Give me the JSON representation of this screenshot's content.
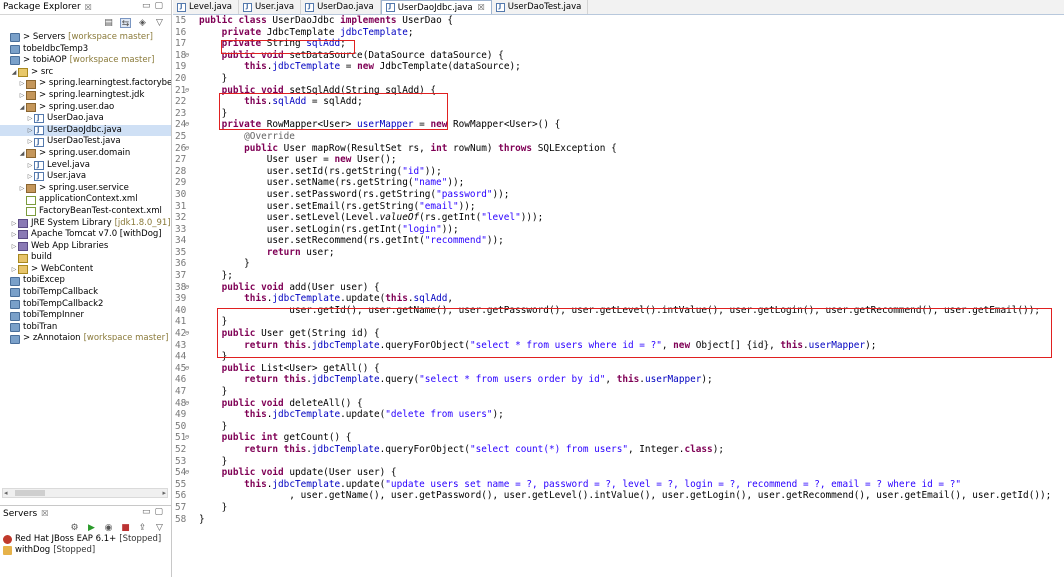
{
  "package_explorer": {
    "title": "Package Explorer",
    "close_glyph": "☒",
    "tree": [
      {
        "indent": 0,
        "twisty": "",
        "icon": "project",
        "label": "> Servers",
        "deco": "[workspace master]"
      },
      {
        "indent": 0,
        "twisty": "",
        "icon": "project",
        "label": "tobeIdbcTemp3",
        "deco": ""
      },
      {
        "indent": 0,
        "twisty": "",
        "icon": "project",
        "label": "> tobiAOP",
        "deco": "[workspace master]"
      },
      {
        "indent": 1,
        "twisty": "◢",
        "icon": "srcfolder",
        "label": "> src",
        "deco": ""
      },
      {
        "indent": 2,
        "twisty": "▷",
        "icon": "package",
        "label": "> spring.learningtest.factorybean",
        "deco": ""
      },
      {
        "indent": 2,
        "twisty": "▷",
        "icon": "package",
        "label": "> spring.learningtest.jdk",
        "deco": ""
      },
      {
        "indent": 2,
        "twisty": "◢",
        "icon": "package",
        "label": "> spring.user.dao",
        "deco": ""
      },
      {
        "indent": 3,
        "twisty": "▷",
        "icon": "java",
        "label": "UserDao.java",
        "deco": ""
      },
      {
        "indent": 3,
        "twisty": "▷",
        "icon": "java",
        "label": "UserDaoJdbc.java",
        "deco": "",
        "selected": true
      },
      {
        "indent": 3,
        "twisty": "▷",
        "icon": "java",
        "label": "UserDaoTest.java",
        "deco": ""
      },
      {
        "indent": 2,
        "twisty": "◢",
        "icon": "package",
        "label": "> spring.user.domain",
        "deco": ""
      },
      {
        "indent": 3,
        "twisty": "▷",
        "icon": "java",
        "label": "Level.java",
        "deco": ""
      },
      {
        "indent": 3,
        "twisty": "▷",
        "icon": "java",
        "label": "User.java",
        "deco": ""
      },
      {
        "indent": 2,
        "twisty": "▷",
        "icon": "package",
        "label": "> spring.user.service",
        "deco": ""
      },
      {
        "indent": 2,
        "twisty": "",
        "icon": "xml",
        "label": "applicationContext.xml",
        "deco": ""
      },
      {
        "indent": 2,
        "twisty": "",
        "icon": "xml",
        "label": "FactoryBeanTest-context.xml",
        "deco": ""
      },
      {
        "indent": 1,
        "twisty": "▷",
        "icon": "lib",
        "label": "JRE System Library",
        "deco": "[jdk1.8.0_91]"
      },
      {
        "indent": 1,
        "twisty": "▷",
        "icon": "lib",
        "label": "Apache Tomcat v7.0 [withDog]",
        "deco": ""
      },
      {
        "indent": 1,
        "twisty": "▷",
        "icon": "lib",
        "label": "Web App Libraries",
        "deco": ""
      },
      {
        "indent": 1,
        "twisty": "",
        "icon": "folder",
        "label": "build",
        "deco": ""
      },
      {
        "indent": 1,
        "twisty": "▷",
        "icon": "folder",
        "label": "> WebContent",
        "deco": ""
      },
      {
        "indent": 0,
        "twisty": "",
        "icon": "project",
        "label": "tobiExcep",
        "deco": ""
      },
      {
        "indent": 0,
        "twisty": "",
        "icon": "project",
        "label": "tobiTempCallback",
        "deco": ""
      },
      {
        "indent": 0,
        "twisty": "",
        "icon": "project",
        "label": "tobiTempCallback2",
        "deco": ""
      },
      {
        "indent": 0,
        "twisty": "",
        "icon": "project",
        "label": "tobiTempInner",
        "deco": ""
      },
      {
        "indent": 0,
        "twisty": "",
        "icon": "project",
        "label": "tobiTran",
        "deco": ""
      },
      {
        "indent": 0,
        "twisty": "",
        "icon": "project",
        "label": "> zAnnotaion",
        "deco": "[workspace master]"
      }
    ]
  },
  "servers_view": {
    "title": "Servers",
    "close_glyph": "☒",
    "items": [
      {
        "icon": "jboss",
        "label": "Red Hat JBoss EAP 6.1+",
        "status": "[Stopped]"
      },
      {
        "icon": "tomcat",
        "label": "withDog",
        "status": "[Stopped]"
      }
    ]
  },
  "editor": {
    "tabs": [
      {
        "label": "Level.java",
        "active": false
      },
      {
        "label": "User.java",
        "active": false
      },
      {
        "label": "UserDao.java",
        "active": false
      },
      {
        "label": "UserDaoJdbc.java",
        "active": true
      },
      {
        "label": "UserDaoTest.java",
        "active": false
      }
    ],
    "tab_close_glyph": "☒",
    "lines": [
      {
        "n": "15",
        "fold": false,
        "t": "[k]public class[/k] UserDaoJdbc [k]implements[/k] UserDao {"
      },
      {
        "n": "16",
        "fold": false,
        "t": "    [k]private[/k] JdbcTemplate [f]jdbcTemplate[/f];"
      },
      {
        "n": "17",
        "fold": false,
        "t": "    [k]private[/k] String [f]sqlAdd[/f];"
      },
      {
        "n": "18",
        "fold": true,
        "t": "    [k]public void[/k] setDataSource(DataSource dataSource) {"
      },
      {
        "n": "19",
        "fold": false,
        "t": "        [k]this[/k].[f]jdbcTemplate[/f] = [k]new[/k] JdbcTemplate(dataSource);"
      },
      {
        "n": "20",
        "fold": false,
        "t": "    }"
      },
      {
        "n": "21",
        "fold": true,
        "t": "    [k]public void[/k] setSqlAdd(String sqlAdd) {"
      },
      {
        "n": "22",
        "fold": false,
        "t": "        [k]this[/k].[f]sqlAdd[/f] = sqlAdd;"
      },
      {
        "n": "23",
        "fold": false,
        "t": "    }"
      },
      {
        "n": "24",
        "fold": true,
        "t": "    [k]private[/k] RowMapper<User> [f]userMapper[/f] = [k]new[/k] RowMapper<User>() {"
      },
      {
        "n": "25",
        "fold": false,
        "t": "        [a]@Override[/a]"
      },
      {
        "n": "26",
        "fold": true,
        "t": "        [k]public[/k] User mapRow(ResultSet rs, [k]int[/k] rowNum) [k]throws[/k] SQLException {"
      },
      {
        "n": "27",
        "fold": false,
        "t": "            User user = [k]new[/k] User();"
      },
      {
        "n": "28",
        "fold": false,
        "t": "            user.setId(rs.getString([s]\"id\"[/s]));"
      },
      {
        "n": "29",
        "fold": false,
        "t": "            user.setName(rs.getString([s]\"name\"[/s]));"
      },
      {
        "n": "30",
        "fold": false,
        "t": "            user.setPassword(rs.getString([s]\"password\"[/s]));"
      },
      {
        "n": "31",
        "fold": false,
        "t": "            user.setEmail(rs.getString([s]\"email\"[/s]));"
      },
      {
        "n": "32",
        "fold": false,
        "t": "            user.setLevel(Level.[i]valueOf[/i](rs.getInt([s]\"level\"[/s])));"
      },
      {
        "n": "33",
        "fold": false,
        "t": "            user.setLogin(rs.getInt([s]\"login\"[/s]));"
      },
      {
        "n": "34",
        "fold": false,
        "t": "            user.setRecommend(rs.getInt([s]\"recommend\"[/s]));"
      },
      {
        "n": "35",
        "fold": false,
        "t": "            [k]return[/k] user;"
      },
      {
        "n": "36",
        "fold": false,
        "t": "        }"
      },
      {
        "n": "37",
        "fold": false,
        "t": "    };"
      },
      {
        "n": "38",
        "fold": true,
        "t": "    [k]public void[/k] add(User user) {"
      },
      {
        "n": "39",
        "fold": false,
        "t": "        [k]this[/k].[f]jdbcTemplate[/f].update([k]this[/k].[f]sqlAdd[/f],"
      },
      {
        "n": "40",
        "fold": false,
        "t": "                user.getId(), user.getName(), user.getPassword(), user.getLevel().intValue(), user.getLogin(), user.getRecommend(), user.getEmail());"
      },
      {
        "n": "41",
        "fold": false,
        "t": "    }"
      },
      {
        "n": "42",
        "fold": true,
        "t": "    [k]public[/k] User get(String id) {"
      },
      {
        "n": "43",
        "fold": false,
        "t": "        [k]return this[/k].[f]jdbcTemplate[/f].queryForObject([s]\"select * from users where id = ?\"[/s], [k]new[/k] Object[] {id}, [k]this[/k].[f]userMapper[/f]);"
      },
      {
        "n": "44",
        "fold": false,
        "t": "    }"
      },
      {
        "n": "45",
        "fold": true,
        "t": "    [k]public[/k] List<User> getAll() {"
      },
      {
        "n": "46",
        "fold": false,
        "t": "        [k]return this[/k].[f]jdbcTemplate[/f].query([s]\"select * from users order by id\"[/s], [k]this[/k].[f]userMapper[/f]);"
      },
      {
        "n": "47",
        "fold": false,
        "t": "    }"
      },
      {
        "n": "48",
        "fold": true,
        "t": "    [k]public void[/k] deleteAll() {"
      },
      {
        "n": "49",
        "fold": false,
        "t": "        [k]this[/k].[f]jdbcTemplate[/f].update([s]\"delete from users\"[/s]);"
      },
      {
        "n": "50",
        "fold": false,
        "t": "    }"
      },
      {
        "n": "51",
        "fold": true,
        "t": "    [k]public int[/k] getCount() {"
      },
      {
        "n": "52",
        "fold": false,
        "t": "        [k]return this[/k].[f]jdbcTemplate[/f].queryForObject([s]\"select count(*) from users\"[/s], Integer.[k]class[/k]);"
      },
      {
        "n": "53",
        "fold": false,
        "t": "    }"
      },
      {
        "n": "54",
        "fold": true,
        "t": "    [k]public void[/k] update(User user) {"
      },
      {
        "n": "55",
        "fold": false,
        "t": "        [k]this[/k].[f]jdbcTemplate[/f].update([s]\"update users set name = ?, password = ?, level = ?, login = ?, recommend = ?, email = ? where id = ?\"[/s]"
      },
      {
        "n": "56",
        "fold": false,
        "t": "                , user.getName(), user.getPassword(), user.getLevel().intValue(), user.getLogin(), user.getRecommend(), user.getEmail(), user.getId());"
      },
      {
        "n": "57",
        "fold": false,
        "t": "    }"
      },
      {
        "n": "58",
        "fold": false,
        "t": "}"
      }
    ]
  },
  "colors": {
    "keyword": "#7f0055",
    "field": "#0000c0",
    "string": "#2a00ff",
    "annotation": "#646464",
    "highlight_box": "#e02020"
  }
}
